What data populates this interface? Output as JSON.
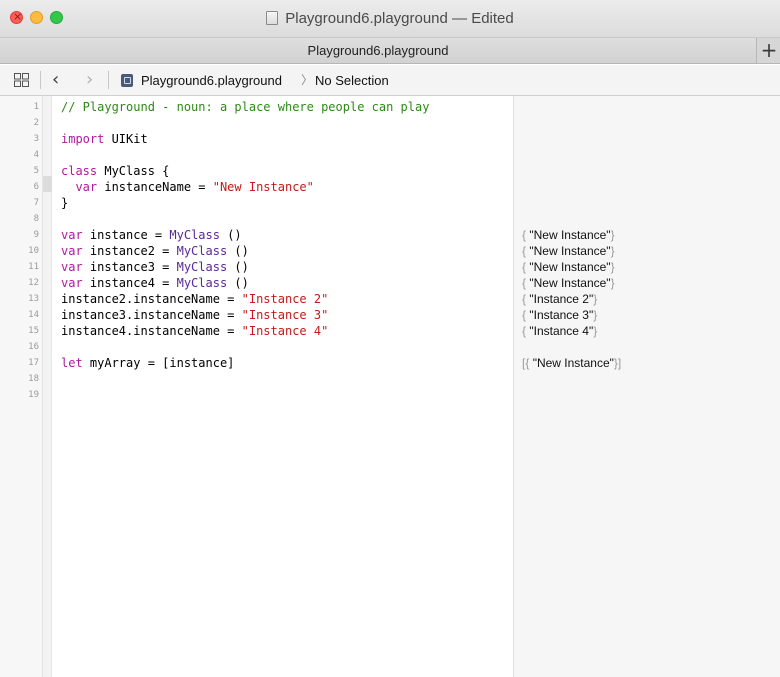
{
  "window": {
    "title": "Playground6.playground — Edited",
    "close_glyph": "×"
  },
  "tabbar": {
    "active_tab": "Playground6.playground",
    "add_glyph": "+"
  },
  "jumpbar": {
    "back_glyph": "‹",
    "forward_glyph": "›",
    "file": "Playground6.playground",
    "arrow": "〉",
    "selection": "No Selection"
  },
  "editor": {
    "line_numbers": [
      "1",
      "2",
      "3",
      "4",
      "5",
      "6",
      "7",
      "8",
      "9",
      "10",
      "11",
      "12",
      "13",
      "14",
      "15",
      "16",
      "17",
      "18",
      "19"
    ],
    "lines": [
      {
        "n": 1,
        "parts": [
          {
            "t": "// Playground - noun: a place where people can play",
            "c": "comment"
          }
        ]
      },
      {
        "n": 2,
        "parts": []
      },
      {
        "n": 3,
        "parts": [
          {
            "t": "import",
            "c": "keyword"
          },
          {
            "t": " UIKit",
            "c": "plain"
          }
        ]
      },
      {
        "n": 4,
        "parts": []
      },
      {
        "n": 5,
        "parts": [
          {
            "t": "class",
            "c": "keyword"
          },
          {
            "t": " MyClass {",
            "c": "plain"
          }
        ]
      },
      {
        "n": 6,
        "parts": [
          {
            "t": "  var",
            "c": "keyword"
          },
          {
            "t": " instanceName = ",
            "c": "plain"
          },
          {
            "t": "\"New Instance\"",
            "c": "string"
          }
        ]
      },
      {
        "n": 7,
        "parts": [
          {
            "t": "}",
            "c": "plain"
          }
        ]
      },
      {
        "n": 8,
        "parts": []
      },
      {
        "n": 9,
        "parts": [
          {
            "t": "var",
            "c": "keyword"
          },
          {
            "t": " instance = ",
            "c": "plain"
          },
          {
            "t": "MyClass",
            "c": "type"
          },
          {
            "t": " ()",
            "c": "plain"
          }
        ]
      },
      {
        "n": 10,
        "parts": [
          {
            "t": "var",
            "c": "keyword"
          },
          {
            "t": " instance2 = ",
            "c": "plain"
          },
          {
            "t": "MyClass",
            "c": "type"
          },
          {
            "t": " ()",
            "c": "plain"
          }
        ]
      },
      {
        "n": 11,
        "parts": [
          {
            "t": "var",
            "c": "keyword"
          },
          {
            "t": " instance3 = ",
            "c": "plain"
          },
          {
            "t": "MyClass",
            "c": "type"
          },
          {
            "t": " ()",
            "c": "plain"
          }
        ]
      },
      {
        "n": 12,
        "parts": [
          {
            "t": "var",
            "c": "keyword"
          },
          {
            "t": " instance4 = ",
            "c": "plain"
          },
          {
            "t": "MyClass",
            "c": "type"
          },
          {
            "t": " ()",
            "c": "plain"
          }
        ]
      },
      {
        "n": 13,
        "parts": [
          {
            "t": "instance2.instanceName = ",
            "c": "plain"
          },
          {
            "t": "\"Instance 2\"",
            "c": "string"
          }
        ]
      },
      {
        "n": 14,
        "parts": [
          {
            "t": "instance3.instanceName = ",
            "c": "plain"
          },
          {
            "t": "\"Instance 3\"",
            "c": "string"
          }
        ]
      },
      {
        "n": 15,
        "parts": [
          {
            "t": "instance4.instanceName = ",
            "c": "plain"
          },
          {
            "t": "\"Instance 4\"",
            "c": "string"
          }
        ]
      },
      {
        "n": 16,
        "parts": []
      },
      {
        "n": 17,
        "parts": [
          {
            "t": "let",
            "c": "keyword"
          },
          {
            "t": " myArray = [instance]",
            "c": "plain"
          }
        ]
      },
      {
        "n": 18,
        "parts": []
      },
      {
        "n": 19,
        "parts": []
      }
    ]
  },
  "results": [
    {
      "line": 9,
      "open": "{ ",
      "text": "\"New Instance\"",
      "close": "}"
    },
    {
      "line": 10,
      "open": "{ ",
      "text": "\"New Instance\"",
      "close": "}"
    },
    {
      "line": 11,
      "open": "{ ",
      "text": "\"New Instance\"",
      "close": "}"
    },
    {
      "line": 12,
      "open": "{ ",
      "text": "\"New Instance\"",
      "close": "}"
    },
    {
      "line": 13,
      "open": "{ ",
      "text": "\"Instance 2\"",
      "close": "}"
    },
    {
      "line": 14,
      "open": "{ ",
      "text": "\"Instance 3\"",
      "close": "}"
    },
    {
      "line": 15,
      "open": "{ ",
      "text": "\"Instance 4\"",
      "close": "}"
    },
    {
      "line": 17,
      "open": "[{ ",
      "text": "\"New Instance\"",
      "close": "}]"
    }
  ],
  "colors": {
    "comment": "#2d8a17",
    "keyword": "#b01a9c",
    "string": "#c41a16",
    "type": "#5b2699"
  }
}
